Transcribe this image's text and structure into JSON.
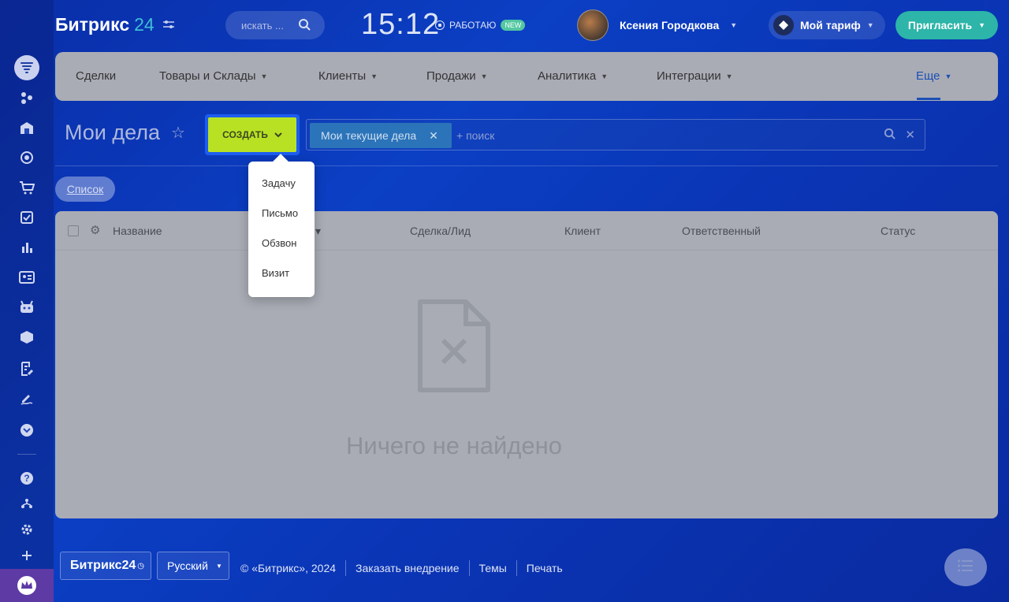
{
  "rail": {
    "items": [
      "filter-icon",
      "activity-icon",
      "bank-icon",
      "target-icon",
      "cart-icon",
      "task-icon",
      "chart-icon",
      "contact-card-icon",
      "robot-icon",
      "box-icon",
      "document-edit-icon",
      "signature-icon",
      "more-icon",
      "help-icon",
      "sitemap-icon",
      "settings-icon",
      "plus-icon",
      "crown-icon"
    ]
  },
  "header": {
    "logo_text": "Битрикс",
    "logo_num": "24",
    "search_placeholder": "искать ...",
    "clock": "15:12",
    "work_status": "РАБОТАЮ",
    "new_badge": "NEW",
    "user_name": "Ксения Городкова",
    "tariff_label": "Мой тариф",
    "invite_label": "Пригласить"
  },
  "nav": {
    "tabs": [
      "Сделки",
      "Товары и Склады",
      "Клиенты",
      "Продажи",
      "Аналитика",
      "Интеграции"
    ],
    "more": "Еще"
  },
  "page": {
    "title": "Мои дела",
    "create_label": "СОЗДАТЬ",
    "filter_chip": "Мои текущие дела",
    "filter_placeholder": "+ поиск",
    "list_button": "Список"
  },
  "table": {
    "columns": [
      "Название",
      "Сделка/Лид",
      "Клиент",
      "Ответственный",
      "Статус"
    ],
    "empty_text": "Ничего не найдено"
  },
  "dropdown": {
    "options": [
      "Задачу",
      "Письмо",
      "Обзвон",
      "Визит"
    ]
  },
  "footer": {
    "logo": "Битрикс24",
    "language": "Русский",
    "copyright": "© «Битрикс», 2024",
    "links": [
      "Заказать внедрение",
      "Темы",
      "Печать"
    ]
  },
  "colors": {
    "accent": "#b9e124",
    "invite": "#2cb5a8",
    "brand_blue": "#1d5df0"
  }
}
